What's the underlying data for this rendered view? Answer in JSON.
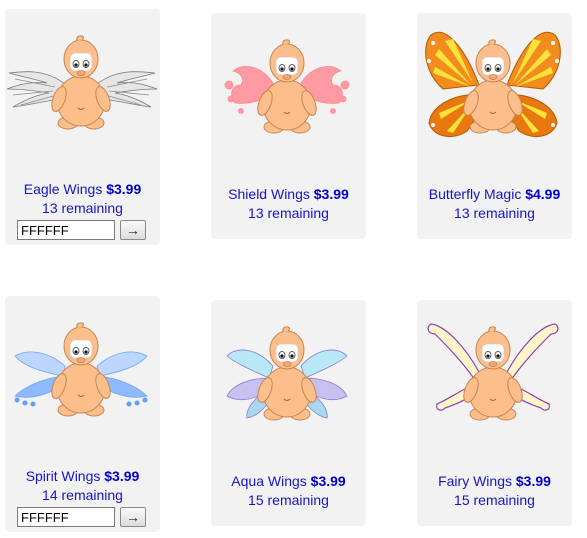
{
  "items": [
    {
      "name": "Eagle Wings",
      "price": "$3.99",
      "remaining": "13 remaining",
      "color_value": "FFFFFF",
      "button_glyph": "→",
      "wings_icon": "eagle-wings-icon"
    },
    {
      "name": "Shield Wings",
      "price": "$3.99",
      "remaining": "13 remaining",
      "wings_icon": "shield-wings-icon"
    },
    {
      "name": "Butterfly Magic",
      "price": "$4.99",
      "remaining": "13 remaining",
      "wings_icon": "butterfly-wings-icon"
    },
    {
      "name": "Spirit Wings",
      "price": "$3.99",
      "remaining": "14 remaining",
      "color_value": "FFFFFF",
      "button_glyph": "→",
      "wings_icon": "spirit-wings-icon"
    },
    {
      "name": "Aqua Wings",
      "price": "$3.99",
      "remaining": "15 remaining",
      "wings_icon": "aqua-wings-icon"
    },
    {
      "name": "Fairy Wings",
      "price": "$3.99",
      "remaining": "15 remaining",
      "wings_icon": "fairy-wings-icon"
    }
  ],
  "colors": {
    "card_background": "#f2f2f2",
    "link_text": "#1515c8",
    "price_text": "#0000cc",
    "character_skin": "#fcbf8c"
  }
}
